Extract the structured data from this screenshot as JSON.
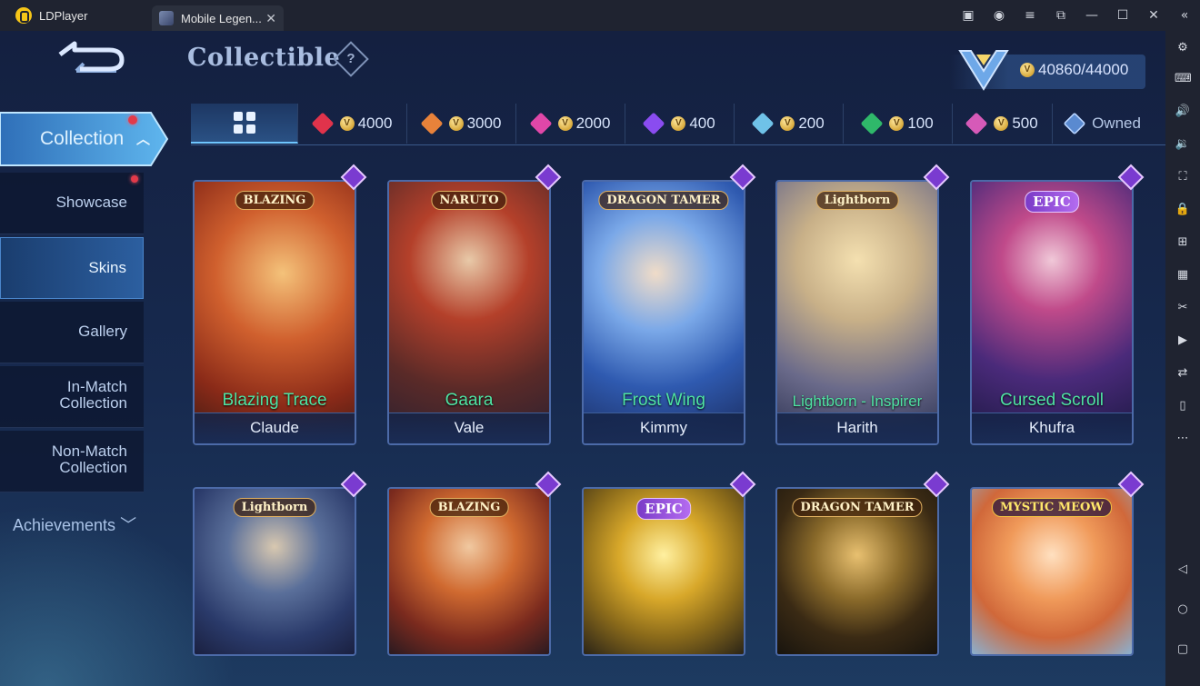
{
  "window": {
    "app_name": "LDPlayer",
    "tab_title": "Mobile Legen...",
    "tab_close": "✕"
  },
  "game": {
    "page_title": "Collectible",
    "help_icon": "?",
    "currency_value": "40860/44000",
    "nav": {
      "collection": "Collection",
      "showcase": "Showcase",
      "skins": "Skins",
      "gallery": "Gallery",
      "in_match": "In-Match Collection",
      "non_match": "Non-Match Collection",
      "achievements": "Achievements"
    },
    "filters": [
      {
        "label": "4000",
        "gem_color": "#e0334b"
      },
      {
        "label": "3000",
        "gem_color": "#e8823a"
      },
      {
        "label": "2000",
        "gem_color": "#e047a8"
      },
      {
        "label": "400",
        "gem_color": "#8a4cf0"
      },
      {
        "label": "200",
        "gem_color": "#6fc2e8"
      },
      {
        "label": "100",
        "gem_color": "#2fb86a"
      },
      {
        "label": "500",
        "gem_color": "#d65ab8"
      }
    ],
    "owned_label": "Owned",
    "cards_row1": [
      {
        "brand": "BLAZING",
        "skin": "Blazing Trace",
        "hero": "Claude",
        "art": "#b8331e"
      },
      {
        "brand": "NARUTO",
        "skin": "Gaara",
        "hero": "Vale",
        "art": "#7a2e22"
      },
      {
        "brand": "DRAGON TAMER",
        "skin": "Frost Wing",
        "hero": "Kimmy",
        "art": "#3b6fc0"
      },
      {
        "brand": "Lightborn",
        "skin": "Lightborn - Inspirer",
        "hero": "Harith",
        "art": "#b8a27a"
      },
      {
        "brand": "EPIC",
        "skin": "Cursed Scroll",
        "hero": "Khufra",
        "art": "#3a2a6a"
      }
    ],
    "cards_row2": [
      {
        "brand": "Lightborn",
        "art": "#4a5f8a"
      },
      {
        "brand": "BLAZING",
        "art": "#c0542a"
      },
      {
        "brand": "EPIC",
        "art": "#a8861e"
      },
      {
        "brand": "DRAGON TAMER",
        "art": "#5a4a1e"
      },
      {
        "brand": "MYSTIC MEOW",
        "art": "#e8924a"
      }
    ]
  }
}
